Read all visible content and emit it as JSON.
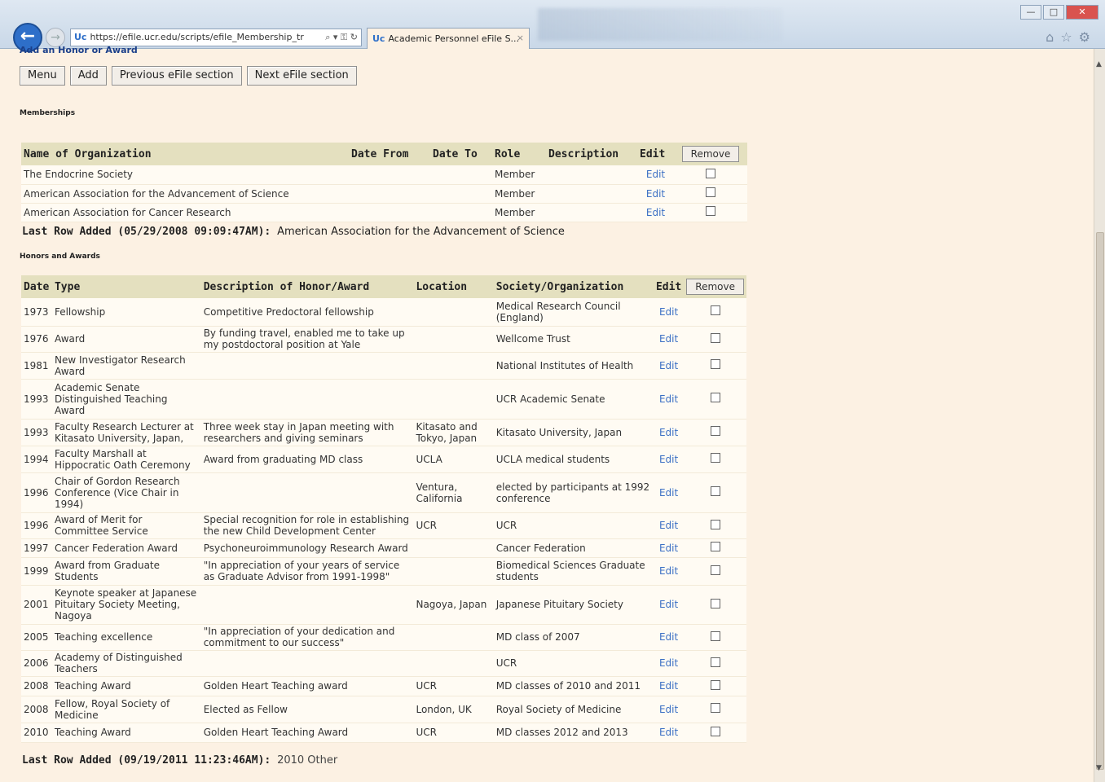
{
  "browser": {
    "address": "https://efile.ucr.edu/scripts/efile_Membership_tr",
    "address_host": "efile.ucr.edu",
    "tab_title": "Academic Personnel eFile S...",
    "tab_close": "×",
    "back_glyph": "←",
    "forward_glyph": "→",
    "min_glyph": "—",
    "max_glyph": "□",
    "close_glyph": "✕",
    "tools_glyphs": "⌂☆⚙"
  },
  "page": {
    "top_link": "Add an Honor or Award",
    "buttons": {
      "menu": "Menu",
      "add": "Add",
      "previous": "Previous eFile section",
      "next": "Next eFile section"
    },
    "memberships": {
      "section_title": "Memberships",
      "headers": {
        "name": "Name of Organization",
        "date_from": "Date From",
        "date_to": "Date To",
        "role": "Role",
        "description": "Description",
        "edit": "Edit",
        "remove": "Remove"
      },
      "rows": [
        {
          "name": "The Endocrine Society",
          "date_from": "",
          "date_to": "",
          "role": "Member",
          "description": "",
          "edit": "Edit"
        },
        {
          "name": "American Association for the Advancement of Science",
          "date_from": "",
          "date_to": "",
          "role": "Member",
          "description": "",
          "edit": "Edit"
        },
        {
          "name": "American Association for Cancer Research",
          "date_from": "",
          "date_to": "",
          "role": "Member",
          "description": "",
          "edit": "Edit"
        }
      ],
      "last_row_label": "Last Row Added (05/29/2008 09:09:47AM):",
      "last_row_value": "American Association for the Advancement of Science"
    },
    "honors": {
      "section_title": "Honors and Awards",
      "headers": {
        "date": "Date",
        "type": "Type",
        "description": "Description of Honor/Award",
        "location": "Location",
        "society": "Society/Organization",
        "edit": "Edit",
        "remove": "Remove"
      },
      "rows": [
        {
          "date": "1973",
          "type": "Fellowship",
          "description": "Competitive Predoctoral fellowship",
          "location": "",
          "society": "Medical Research Council (England)",
          "edit": "Edit"
        },
        {
          "date": "1976",
          "type": "Award",
          "description": "By funding travel, enabled me to take up my postdoctoral position at Yale",
          "location": "",
          "society": "Wellcome Trust",
          "edit": "Edit"
        },
        {
          "date": "1981",
          "type": "New Investigator Research Award",
          "description": "",
          "location": "",
          "society": "National Institutes of Health",
          "edit": "Edit"
        },
        {
          "date": "1993",
          "type": "Academic Senate Distinguished Teaching Award",
          "description": "",
          "location": "",
          "society": "UCR Academic Senate",
          "edit": "Edit"
        },
        {
          "date": "1993",
          "type": "Faculty Research Lecturer at Kitasato University, Japan,",
          "description": "Three week stay in Japan meeting with researchers and giving seminars",
          "location": "Kitasato and Tokyo, Japan",
          "society": "Kitasato University, Japan",
          "edit": "Edit"
        },
        {
          "date": "1994",
          "type": "Faculty Marshall at Hippocratic Oath Ceremony",
          "description": "Award from graduating MD class",
          "location": "UCLA",
          "society": "UCLA medical students",
          "edit": "Edit"
        },
        {
          "date": "1996",
          "type": "Chair of Gordon Research Conference (Vice Chair in 1994)",
          "description": "",
          "location": "Ventura, California",
          "society": "elected by participants at 1992 conference",
          "edit": "Edit"
        },
        {
          "date": "1996",
          "type": "Award of Merit for Committee Service",
          "description": "Special recognition for role in establishing the new Child Development Center",
          "location": "UCR",
          "society": "UCR",
          "edit": "Edit"
        },
        {
          "date": "1997",
          "type": "Cancer Federation Award",
          "description": "Psychoneuroimmunology Research Award",
          "location": "",
          "society": "Cancer Federation",
          "edit": "Edit"
        },
        {
          "date": "1999",
          "type": "Award from Graduate Students",
          "description": "\"In appreciation of your years of service as Graduate Advisor from 1991-1998\"",
          "location": "",
          "society": "Biomedical Sciences Graduate students",
          "edit": "Edit"
        },
        {
          "date": "2001",
          "type": "Keynote speaker at Japanese Pituitary Society Meeting, Nagoya",
          "description": "",
          "location": "Nagoya, Japan",
          "society": "Japanese Pituitary Society",
          "edit": "Edit"
        },
        {
          "date": "2005",
          "type": "Teaching excellence",
          "description": "\"In appreciation of your dedication and commitment to our success\"",
          "location": "",
          "society": "MD class of 2007",
          "edit": "Edit"
        },
        {
          "date": "2006",
          "type": "Academy of Distinguished Teachers",
          "description": "",
          "location": "",
          "society": "UCR",
          "edit": "Edit"
        },
        {
          "date": "2008",
          "type": "Teaching Award",
          "description": "Golden Heart Teaching award",
          "location": "UCR",
          "society": "MD classes of 2010 and 2011",
          "edit": "Edit"
        },
        {
          "date": "2008",
          "type": "Fellow, Royal Society of Medicine",
          "description": "Elected as Fellow",
          "location": "London, UK",
          "society": "Royal Society of Medicine",
          "edit": "Edit"
        },
        {
          "date": "2010",
          "type": "Teaching Award",
          "description": "Golden Heart Teaching Award",
          "location": "UCR",
          "society": "MD classes 2012 and 2013",
          "edit": "Edit"
        }
      ],
      "last_row_label": "Last Row Added (09/19/2011 11:23:46AM):",
      "last_row_value": "2010 Other"
    }
  },
  "colors": {
    "page_background": "#fcf1e3",
    "header_background": "#e4e0bf",
    "link_blue": "#3b6fc4"
  }
}
